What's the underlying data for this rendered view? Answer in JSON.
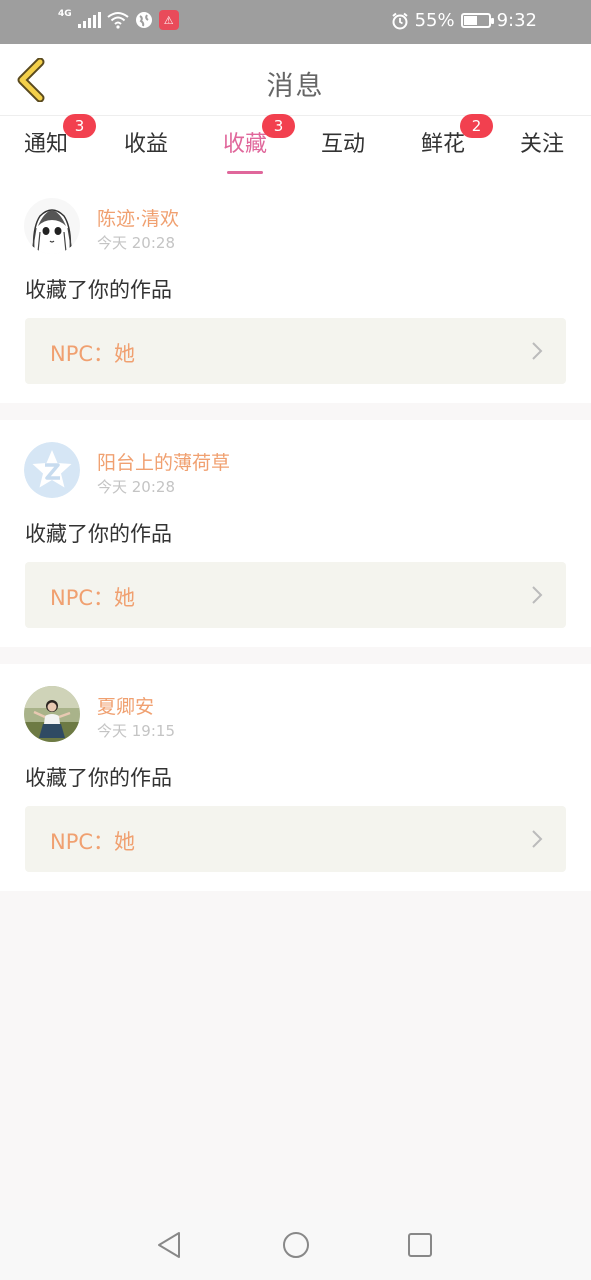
{
  "status_bar": {
    "network": "4G",
    "battery": "55%",
    "battery_level": 0.55,
    "time": "9:32",
    "app_badge": "⚠"
  },
  "header": {
    "back_icon": "chevron-left-icon",
    "title": "消息"
  },
  "tabs": [
    {
      "label": "通知",
      "badge": "3"
    },
    {
      "label": "收益",
      "badge": null
    },
    {
      "label": "收藏",
      "badge": "3",
      "active": true
    },
    {
      "label": "互动",
      "badge": null
    },
    {
      "label": "鲜花",
      "badge": "2"
    },
    {
      "label": "关注",
      "badge": null
    }
  ],
  "colors": {
    "accent": "#e0679b",
    "username": "#f0a070",
    "badge": "#f2404f"
  },
  "feed": [
    {
      "user": "陈迹·清欢",
      "time": "今天 20:28",
      "action": "收藏了你的作品",
      "work": "NPC：她",
      "avatar": "anime-sketch-avatar"
    },
    {
      "user": "阳台上的薄荷草",
      "time": "今天 20:28",
      "action": "收藏了你的作品",
      "work": "NPC：她",
      "avatar": "default-star-avatar"
    },
    {
      "user": "夏卿安",
      "time": "今天 19:15",
      "action": "收藏了你的作品",
      "work": "NPC：她",
      "avatar": "photo-girl-avatar"
    }
  ],
  "nav": {
    "back": "triangle-back-icon",
    "home": "circle-home-icon",
    "recents": "square-recents-icon"
  }
}
